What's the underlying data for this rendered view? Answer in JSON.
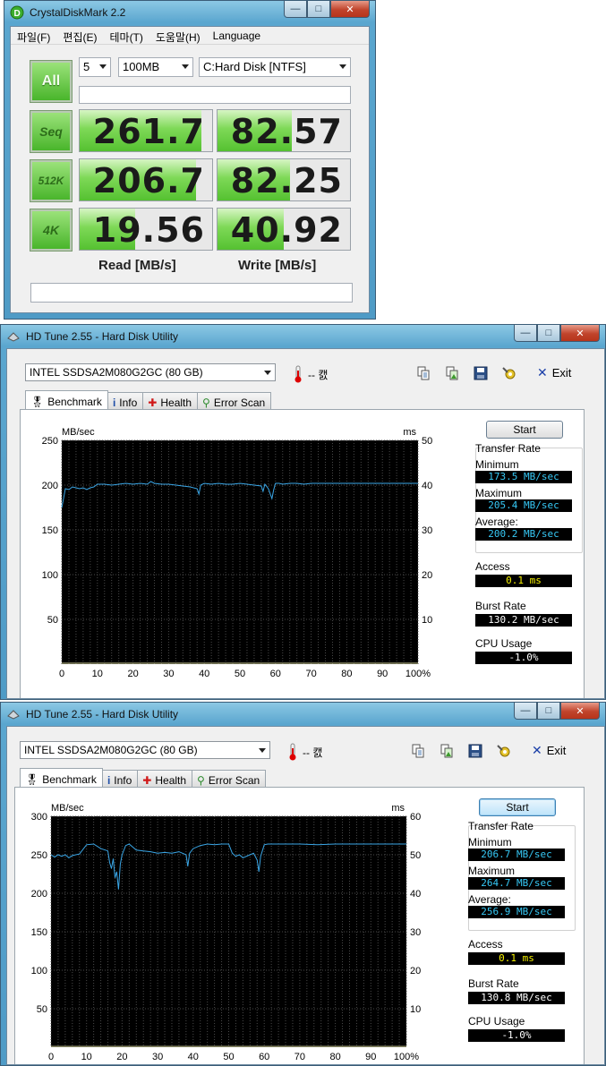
{
  "cdm": {
    "title": "CrystalDiskMark 2.2",
    "menu": [
      "파일(F)",
      "편집(E)",
      "테마(T)",
      "도움말(H)",
      "Language"
    ],
    "all_label": "All",
    "count": "5",
    "size": "100MB",
    "drive": "C:Hard Disk [NTFS]",
    "tests": [
      {
        "label": "Seq",
        "read": "261.7",
        "write": "82.57",
        "read_fill": 0.92,
        "write_fill": 0.56
      },
      {
        "label": "512K",
        "read": "206.7",
        "write": "82.25",
        "read_fill": 0.88,
        "write_fill": 0.55
      },
      {
        "label": "4K",
        "read": "19.56",
        "write": "40.92",
        "read_fill": 0.42,
        "write_fill": 0.5
      }
    ],
    "read_header": "Read [MB/s]",
    "write_header": "Write [MB/s]"
  },
  "hdtune1": {
    "title": "HD Tune 2.55 - Hard Disk Utility",
    "drive": "INTEL SSDSA2M080G2GC (80 GB)",
    "temp": "-- 캜",
    "exit_label": "Exit",
    "tabs": [
      "Benchmark",
      "Info",
      "Health",
      "Error Scan"
    ],
    "start_label": "Start",
    "transfer_rate_label": "Transfer Rate",
    "minimum_label": "Minimum",
    "minimum": "173.5 MB/sec",
    "maximum_label": "Maximum",
    "maximum": "205.4 MB/sec",
    "average_label": "Average:",
    "average": "200.2 MB/sec",
    "access_label": "Access",
    "access": "0.1 ms",
    "burst_label": "Burst Rate",
    "burst": "130.2 MB/sec",
    "cpu_label": "CPU Usage",
    "cpu": "-1.0%"
  },
  "hdtune2": {
    "title": "HD Tune 2.55 - Hard Disk Utility",
    "drive": "INTEL SSDSA2M080G2GC (80 GB)",
    "temp": "-- 캜",
    "exit_label": "Exit",
    "tabs": [
      "Benchmark",
      "Info",
      "Health",
      "Error Scan"
    ],
    "start_label": "Start",
    "transfer_rate_label": "Transfer Rate",
    "minimum_label": "Minimum",
    "minimum": "206.7 MB/sec",
    "maximum_label": "Maximum",
    "maximum": "264.7 MB/sec",
    "average_label": "Average:",
    "average": "256.9 MB/sec",
    "access_label": "Access",
    "access": "0.1 ms",
    "burst_label": "Burst Rate",
    "burst": "130.8 MB/sec",
    "cpu_label": "CPU Usage",
    "cpu": "-1.0%"
  },
  "chart_data": [
    {
      "type": "line",
      "yunit_left": "MB/sec",
      "yunit_right": "ms",
      "x_ticks": [
        "0",
        "10",
        "20",
        "30",
        "40",
        "50",
        "60",
        "70",
        "80",
        "90",
        "100%"
      ],
      "y_ticks_left": [
        "250",
        "200",
        "150",
        "100",
        "50"
      ],
      "y_ticks_right": [
        "50",
        "40",
        "30",
        "20",
        "10"
      ],
      "ylim": [
        0,
        250
      ],
      "y2lim": [
        0,
        50
      ],
      "grid": true,
      "series": [
        {
          "color": "#3aa6e6",
          "x": [
            0,
            0.5,
            1,
            2,
            3,
            4,
            5,
            6,
            7,
            8,
            9,
            10,
            12,
            14,
            16,
            18,
            20,
            22,
            24,
            25,
            26,
            28,
            30,
            32,
            34,
            36,
            38,
            38.5,
            39,
            40,
            42,
            44,
            46,
            48,
            50,
            52,
            54,
            56,
            56.5,
            57,
            58,
            59,
            59.5,
            60,
            61,
            62,
            64,
            66,
            68,
            70,
            75,
            80,
            85,
            90,
            95,
            100
          ],
          "y": [
            175,
            185,
            196,
            195,
            198,
            197,
            196,
            197,
            195,
            197,
            198,
            201,
            201,
            200,
            201,
            202,
            201,
            202,
            201,
            204,
            202,
            201,
            201,
            200,
            199,
            198,
            196,
            190,
            200,
            202,
            201,
            202,
            201,
            201,
            202,
            201,
            200,
            199,
            193,
            201,
            196,
            185,
            195,
            202,
            202,
            201,
            202,
            202,
            201,
            202,
            202,
            202,
            202,
            202,
            202,
            202
          ]
        },
        {
          "color": "#d8d8a0",
          "x": [
            0,
            10,
            20,
            30,
            40,
            50,
            60,
            70,
            80,
            90,
            100
          ],
          "y": [
            1,
            1,
            1,
            1,
            1,
            1,
            1,
            1,
            1,
            1,
            1
          ]
        }
      ]
    },
    {
      "type": "line",
      "yunit_left": "MB/sec",
      "yunit_right": "ms",
      "x_ticks": [
        "0",
        "10",
        "20",
        "30",
        "40",
        "50",
        "60",
        "70",
        "80",
        "90",
        "100%"
      ],
      "y_ticks_left": [
        "300",
        "250",
        "200",
        "150",
        "100",
        "50"
      ],
      "y_ticks_right": [
        "60",
        "50",
        "40",
        "30",
        "20",
        "10"
      ],
      "ylim": [
        0,
        300
      ],
      "y2lim": [
        0,
        60
      ],
      "grid": true,
      "series": [
        {
          "color": "#3aa6e6",
          "x": [
            0,
            1,
            2,
            3,
            4,
            5,
            6,
            8,
            10,
            12,
            14,
            16,
            16.5,
            17,
            17.5,
            18,
            18.5,
            19,
            19.5,
            20,
            21,
            22,
            24,
            26,
            28,
            30,
            32,
            34,
            36,
            38,
            38.5,
            39,
            40,
            42,
            44,
            46,
            48,
            50,
            51,
            52,
            53,
            54,
            56,
            57,
            58,
            58.5,
            59,
            60,
            61,
            62,
            65,
            70,
            75,
            80,
            85,
            90,
            95,
            100
          ],
          "y": [
            250,
            247,
            250,
            248,
            250,
            246,
            249,
            251,
            263,
            264,
            258,
            255,
            240,
            232,
            245,
            220,
            228,
            205,
            238,
            250,
            262,
            264,
            256,
            255,
            254,
            252,
            253,
            252,
            254,
            250,
            235,
            252,
            258,
            262,
            264,
            263,
            264,
            264,
            252,
            248,
            250,
            246,
            250,
            252,
            243,
            228,
            248,
            263,
            264,
            264,
            264,
            264,
            263,
            264,
            264,
            264,
            264,
            264
          ]
        },
        {
          "color": "#d8d8a0",
          "x": [
            0,
            10,
            20,
            30,
            40,
            50,
            60,
            70,
            80,
            90,
            100
          ],
          "y": [
            1,
            1,
            1,
            1,
            1,
            1,
            1,
            1,
            1,
            1,
            1
          ]
        }
      ]
    }
  ]
}
